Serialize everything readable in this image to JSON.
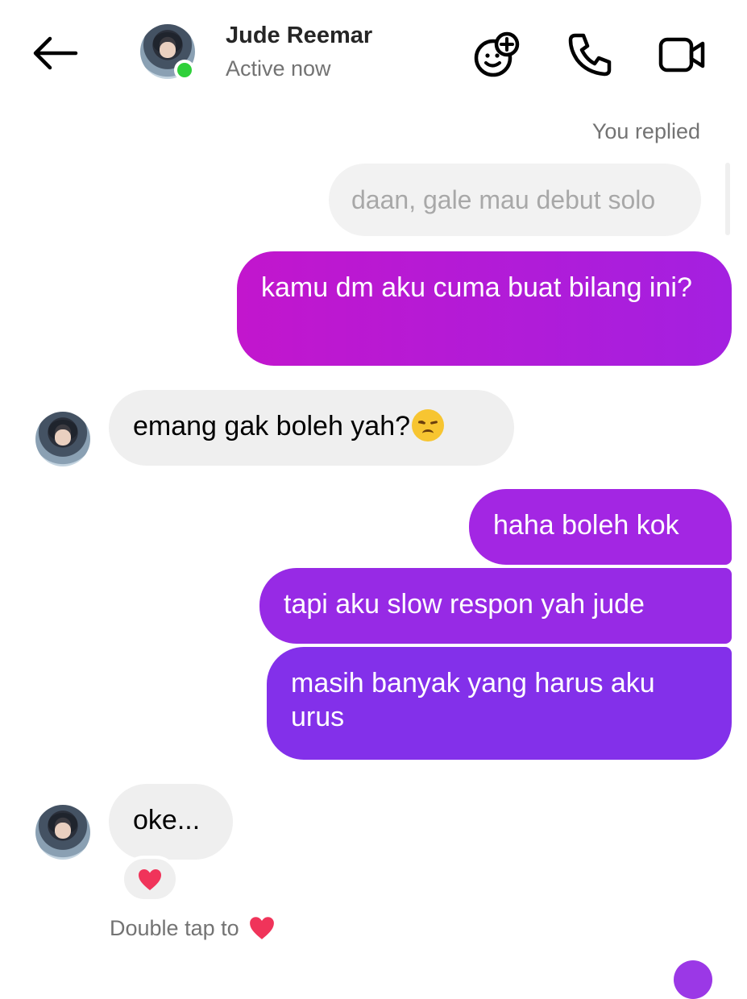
{
  "header": {
    "contact_name": "Jude Reemar",
    "status": "Active now",
    "icons": [
      "arrow-left-icon",
      "sticker-add-icon",
      "phone-icon",
      "video-camera-icon"
    ]
  },
  "thread": {
    "replied_label": "You replied",
    "quoted_message": "daan, gale mau debut solo",
    "messages": [
      {
        "from": "me",
        "text": "kamu dm aku cuma buat bilang ini?"
      },
      {
        "from": "them",
        "text": "emang gak boleh yah?"
      },
      {
        "from": "me",
        "text": "haha boleh kok"
      },
      {
        "from": "me",
        "text": "tapi aku slow respon yah jude"
      },
      {
        "from": "me",
        "text": "masih banyak yang harus aku urus"
      },
      {
        "from": "them",
        "text": "oke..."
      }
    ],
    "reaction": "heart",
    "double_tap_hint": "Double tap to"
  },
  "colors": {
    "bubble_out_start": "#c216cd",
    "bubble_out_end": "#8330ea",
    "bubble_in": "#efefef",
    "online": "#2fd03a",
    "heart": "#f0345a"
  }
}
